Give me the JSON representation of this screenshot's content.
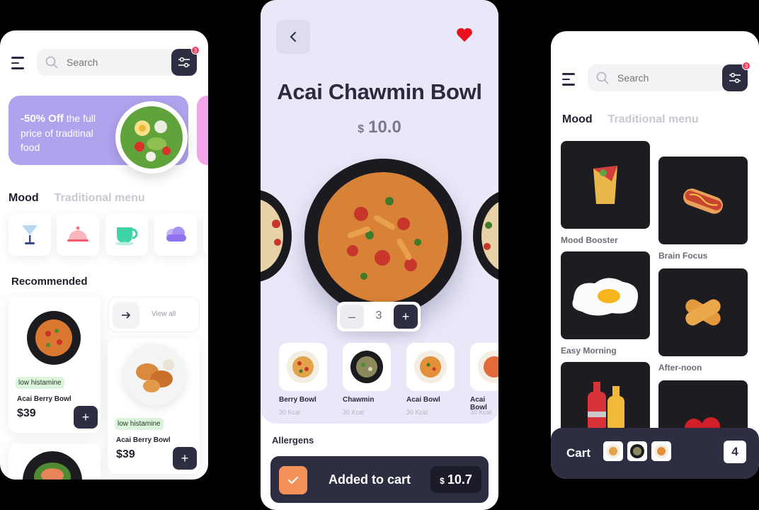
{
  "left": {
    "search": {
      "placeholder": "Search"
    },
    "filter_badge": "3",
    "promo": {
      "highlight": "-50%  Off",
      "text": " the full price of traditinal food"
    },
    "tabs": [
      "Mood",
      "Traditional menu"
    ],
    "mood_icons": [
      "cocktail-glass-icon",
      "cloche-icon",
      "teacup-icon",
      "cloud-icon"
    ],
    "recommended_title": "Recommended",
    "view_all": "View all",
    "items": [
      {
        "tag": "low histamine",
        "name": "Acai Berry Bowl",
        "price": "$39",
        "add": "+"
      },
      {
        "tag": "low histamine",
        "name": "Acai Berry Bowl",
        "price": "$39",
        "add": "+"
      }
    ]
  },
  "middle": {
    "title": "Acai Chawmin Bowl",
    "currency": "$",
    "price": "10.0",
    "quantity": "3",
    "minus": "–",
    "plus": "+",
    "thumbs": [
      {
        "name": "Berry Bowl",
        "kcal": "30 Kcal"
      },
      {
        "name": "Chawmin",
        "kcal": "30 Kcal"
      },
      {
        "name": "Acai Bowl",
        "kcal": "30 Kcal"
      },
      {
        "name": "Acai Bowl",
        "kcal": "30 Kcal"
      }
    ],
    "allergens": "Allergens",
    "cart_button": "Added to cart",
    "cart_currency": "$",
    "cart_total": "10.7"
  },
  "right": {
    "search": {
      "placeholder": "Search"
    },
    "filter_badge": "3",
    "tabs": [
      "Mood",
      "Traditional menu"
    ],
    "tiles": [
      {
        "label": "Mood Booster",
        "icon": "burrito-icon"
      },
      {
        "label": "Brain Focus",
        "icon": "hotdog-icon"
      },
      {
        "label": "Easy Morning",
        "icon": "fried-egg-icon"
      },
      {
        "label": "After-noon",
        "icon": "bread-icon"
      },
      {
        "label": "",
        "icon": "sauce-bottles-icon"
      },
      {
        "label": "",
        "icon": "strawberries-icon"
      }
    ],
    "cart": {
      "label": "Cart",
      "count": "4"
    }
  },
  "colors": {
    "dark": "#2e2e42",
    "promo": "#b1a2ee",
    "detail_bg": "#e9e8f8",
    "accent_orange": "#f5905b",
    "heart_red": "#e8111c",
    "badge_red": "#ef3b5b",
    "tag_green": "#dcf3dc"
  }
}
